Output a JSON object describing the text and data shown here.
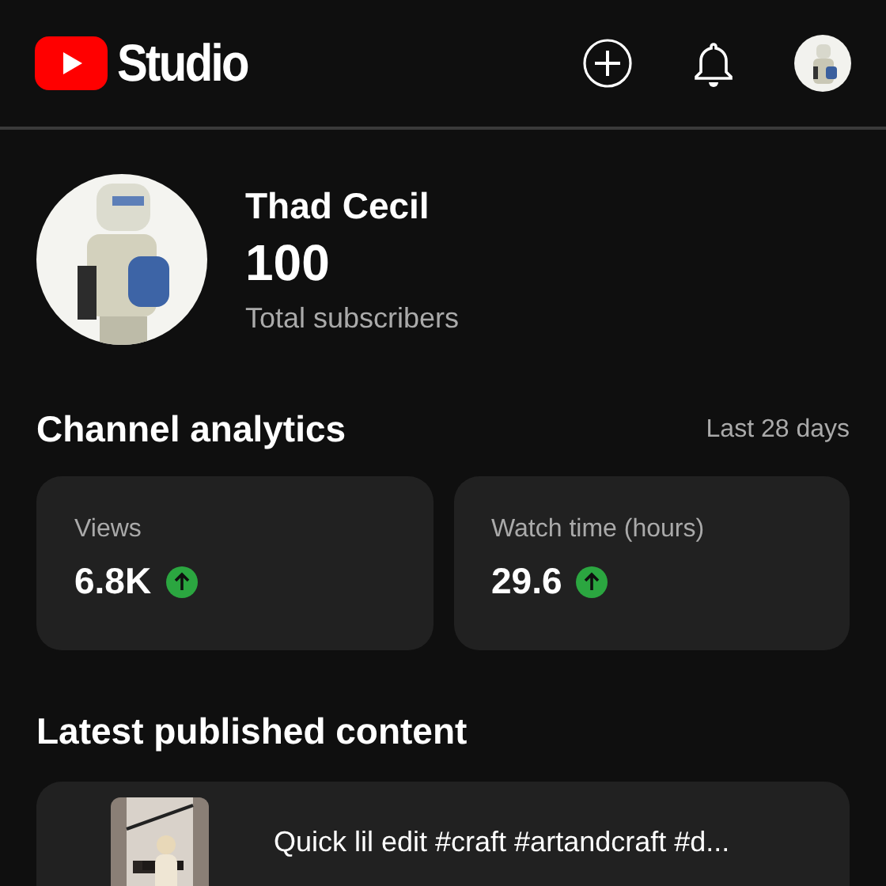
{
  "header": {
    "logo_text": "Studio"
  },
  "channel": {
    "name": "Thad Cecil",
    "subscribers": "100",
    "subscribers_label": "Total subscribers"
  },
  "analytics": {
    "title": "Channel analytics",
    "period": "Last 28 days",
    "metrics": [
      {
        "label": "Views",
        "value": "6.8K",
        "rising": true
      },
      {
        "label": "Watch time (hours)",
        "value": "29.6",
        "rising": true
      }
    ]
  },
  "latest": {
    "title": "Latest published content",
    "items": [
      {
        "title": "Quick lil edit #craft #artandcraft #d..."
      }
    ]
  }
}
